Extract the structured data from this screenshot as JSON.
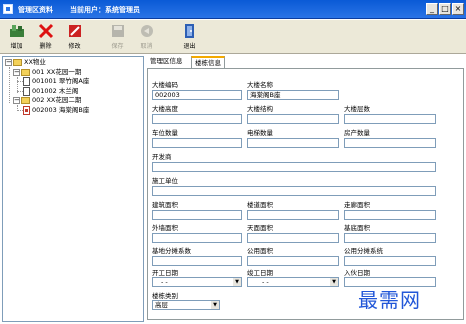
{
  "window": {
    "title": "管理区资料",
    "user_label": "当前用户：系统管理员",
    "buttons": [
      "_",
      "□",
      "×"
    ]
  },
  "toolbar": [
    {
      "label": "增加",
      "icon": "add-icon",
      "enabled": true
    },
    {
      "label": "删除",
      "icon": "delete-icon",
      "enabled": true
    },
    {
      "label": "修改",
      "icon": "edit-icon",
      "enabled": true
    },
    {
      "label": "保存",
      "icon": "save-icon",
      "enabled": false
    },
    {
      "label": "取消",
      "icon": "cancel-icon",
      "enabled": false
    },
    {
      "label": "退出",
      "icon": "exit-icon",
      "enabled": true
    }
  ],
  "tree": {
    "root": "XX物业",
    "groups": [
      {
        "label": "001 XX花园一期",
        "children": [
          "001001 翠竹阁A座",
          "001002 木兰阁"
        ]
      },
      {
        "label": "002 XX花园二期",
        "children": [
          "002003 海棠阁B座"
        ]
      }
    ]
  },
  "tabs": [
    "管理区信息",
    "楼栋信息"
  ],
  "form": {
    "building_code": {
      "label": "大楼编码",
      "value": "002003"
    },
    "building_name": {
      "label": "大楼名称",
      "value": "海棠阁B座"
    },
    "building_height": {
      "label": "大楼高度",
      "value": ""
    },
    "building_structure": {
      "label": "大楼结构",
      "value": ""
    },
    "building_floors": {
      "label": "大楼层数",
      "value": ""
    },
    "parking_count": {
      "label": "车位数量",
      "value": ""
    },
    "elevator_count": {
      "label": "电梯数量",
      "value": ""
    },
    "room_count": {
      "label": "房产数量",
      "value": ""
    },
    "developer": {
      "label": "开发商",
      "value": ""
    },
    "construction_unit": {
      "label": "施工单位",
      "value": ""
    },
    "building_area": {
      "label": "建筑面积",
      "value": ""
    },
    "stair_area": {
      "label": "楼道面积",
      "value": ""
    },
    "corridor_area": {
      "label": "走廊面积",
      "value": ""
    },
    "wall_area": {
      "label": "外墙面积",
      "value": ""
    },
    "roof_area": {
      "label": "天面面积",
      "value": ""
    },
    "basement_area": {
      "label": "基底面积",
      "value": ""
    },
    "base_share_coef": {
      "label": "基地分摊系数",
      "value": ""
    },
    "public_area": {
      "label": "公用面积",
      "value": ""
    },
    "public_share_coef": {
      "label": "公用分摊系统",
      "value": ""
    },
    "start_date": {
      "label": "开工日期",
      "value": "- -"
    },
    "completion_date": {
      "label": "竣工日期",
      "value": "- -"
    },
    "move_in_date": {
      "label": "入伙日期",
      "value": ""
    },
    "building_type": {
      "label": "楼栋类别",
      "value": "高层"
    }
  },
  "watermark": "最需网"
}
